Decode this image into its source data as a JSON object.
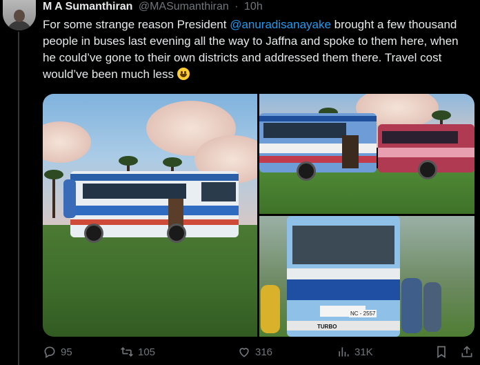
{
  "tweet": {
    "author_name": "M A Sumanthiran",
    "author_handle": "@MASumanthiran",
    "separator": "·",
    "time": "10h",
    "text_part1": "For some strange reason President ",
    "mention": "@anuradisanayake",
    "text_part2": " brought a few thousand people in buses last evening all the way to Jaffna and spoke to them here, when he could’ve gone to their own districts and addressed them there. Travel cost would’ve been much less ",
    "emoji_icon": "smiling-face-emoji"
  },
  "media": {
    "images": [
      {
        "name": "photo-bus-parked-on-grass"
      },
      {
        "name": "photo-two-buses-in-field"
      },
      {
        "name": "photo-bus-front-with-people"
      }
    ],
    "bus_plate": "NC - 2557",
    "bus_brand": "TURBO"
  },
  "actions": {
    "replies": "95",
    "retweets": "105",
    "likes": "316",
    "views": "31K",
    "icons": [
      "reply-icon",
      "retweet-icon",
      "like-icon",
      "views-icon",
      "bookmark-icon",
      "share-icon"
    ]
  },
  "colors": {
    "background": "#000000",
    "text": "#e7e9ea",
    "muted": "#71767b",
    "link": "#1d9bf0"
  }
}
